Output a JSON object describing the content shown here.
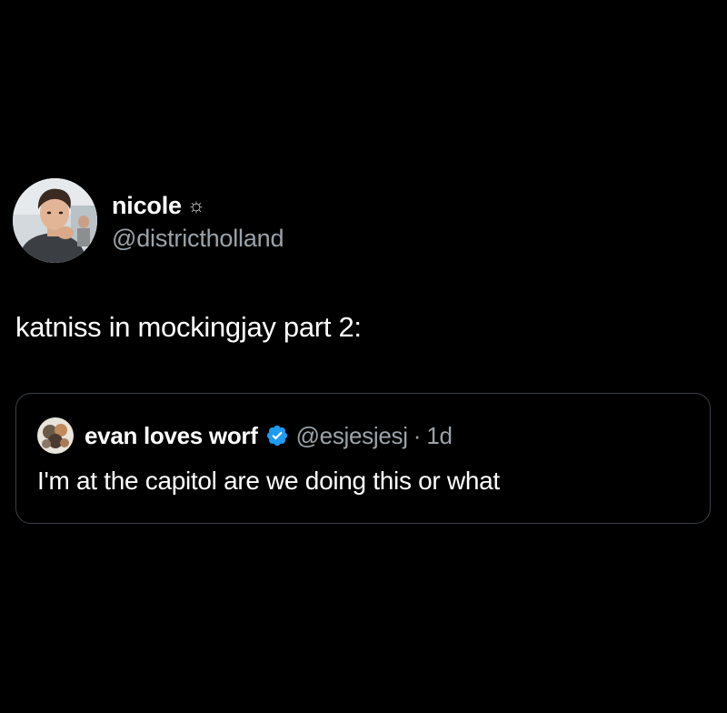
{
  "tweet": {
    "author": {
      "display_name": "nicole",
      "name_decoration": "☼",
      "handle": "@districtholland",
      "avatar_icon": "profile-photo"
    },
    "text": "katniss in mockingjay part 2:",
    "quoted_tweet": {
      "author": {
        "display_name": "evan loves worf",
        "handle": "@esjesjesj",
        "verified": true,
        "avatar_icon": "profile-photo"
      },
      "separator": "·",
      "time": "1d",
      "text": "I'm at the capitol are we doing this or what"
    }
  },
  "colors": {
    "background": "#000000",
    "primary_text": "#ffffff",
    "secondary_text": "#9ba3aa",
    "card_border": "#3b4147",
    "verified_blue": "#1d9bf0"
  }
}
